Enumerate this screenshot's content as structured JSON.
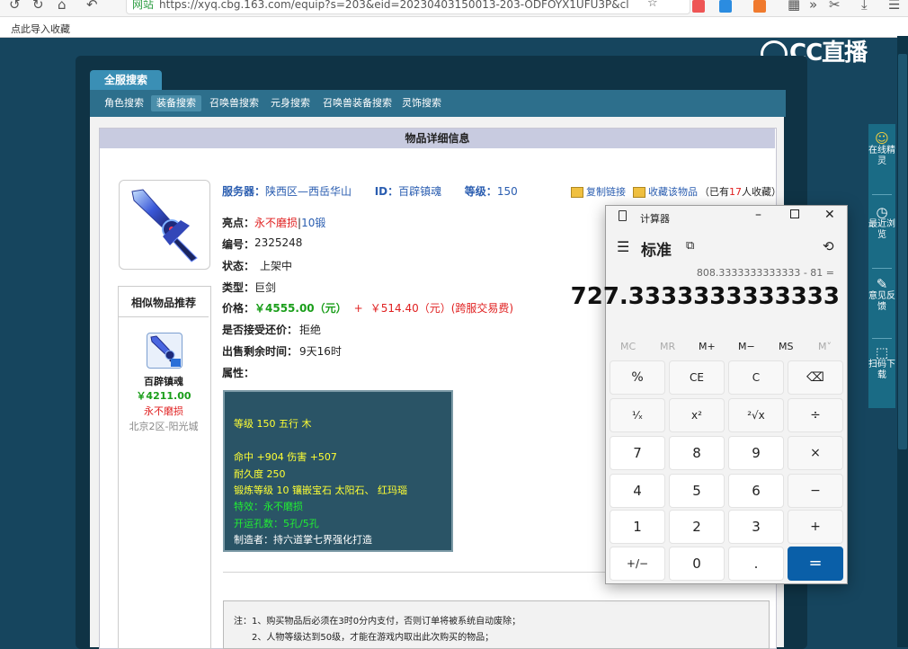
{
  "browser": {
    "url": "https://xyq.cbg.163.com/equip?s=203&eid=20230403150013-203-ODFOYX1UFU3P&cl",
    "secure_label": "网站",
    "bookmark_import": "点此导入收藏"
  },
  "logo": {
    "text": "CC直播"
  },
  "right_panel": {
    "items": [
      {
        "label": "在线精灵",
        "icon": "avatar-icon"
      },
      {
        "label": "最近浏览",
        "icon": "clock-icon"
      },
      {
        "label": "意见反馈",
        "icon": "edit-icon"
      },
      {
        "label": "扫码下载",
        "icon": "scan-icon"
      }
    ]
  },
  "tabs": {
    "main": "全服搜索",
    "sub": [
      "角色搜索",
      "装备搜索",
      "召唤兽搜索",
      "元身搜索",
      "召唤兽装备搜索",
      "灵饰搜索"
    ],
    "active_index": 1
  },
  "detail": {
    "header": "物品详细信息",
    "server_label": "服务器：",
    "server_value": "陕西区—西岳华山",
    "id_label": "ID：",
    "id_value": "百辟镇魂",
    "level_label": "等级：",
    "level_value": "150",
    "copy_link": "复制链接",
    "favorite": "收藏该物品",
    "fav_prefix": "（已有",
    "fav_count": "17",
    "fav_suffix": "人收藏）",
    "highlight_label": "亮点：",
    "highlight_value1": "永不磨损",
    "highlight_sep": "|",
    "highlight_value2": "10锻",
    "number_label": "编号：",
    "number_value": "2325248",
    "status_label": "状态：",
    "status_value": "上架中",
    "type_label": "类型：",
    "type_value": "巨剑",
    "price_label": "价格：",
    "price_value": "￥4555.00（元）",
    "price_plus": "+",
    "price_fee": "￥514.40（元）(跨服交易费)",
    "bargain_label": "是否接受还价：",
    "bargain_value": "拒绝",
    "remain_label": "出售剩余时间：",
    "remain_value": "9天16时",
    "attr_label": "属性："
  },
  "attributes": {
    "line1": "等级 150  五行 木",
    "line2": "命中 +904 伤害 +507",
    "line3": "耐久度 250",
    "line4": "锻炼等级 10  镶嵌宝石 太阳石、 红玛瑙",
    "line5": "特效：永不磨损",
    "line6": "开运孔数：5孔/5孔",
    "line7": "制造者：持六道掌七界强化打造"
  },
  "similar": {
    "header": "相似物品推荐",
    "name": "百辟镇魂",
    "price": "￥4211.00",
    "tag": "永不磨损",
    "server": "北京2区-阳光城"
  },
  "notes": {
    "line1": "注：1、购买物品后必须在3时0分内支付，否则订单将被系统自动废除；",
    "line2": "2、人物等级达到50级，才能在游戏内取出此次购买的物品；"
  },
  "calculator": {
    "title": "计算器",
    "mode": "标准",
    "expression": "808.3333333333333 - 81 =",
    "result": "727.3333333333333",
    "memory": [
      "MC",
      "MR",
      "M+",
      "M−",
      "MS",
      "M˅"
    ],
    "buttons": [
      [
        "%",
        "CE",
        "C",
        "⌫"
      ],
      [
        "¹⁄ₓ",
        "x²",
        "²√x",
        "÷"
      ],
      [
        "7",
        "8",
        "9",
        "×"
      ],
      [
        "4",
        "5",
        "6",
        "−"
      ],
      [
        "1",
        "2",
        "3",
        "+"
      ],
      [
        "+/−",
        "0",
        ".",
        "="
      ]
    ]
  },
  "colors": {
    "accent": "#0a5fa8",
    "page_bg": "#16455e",
    "price_red": "#e02020",
    "price_green": "#1a9e1a"
  }
}
